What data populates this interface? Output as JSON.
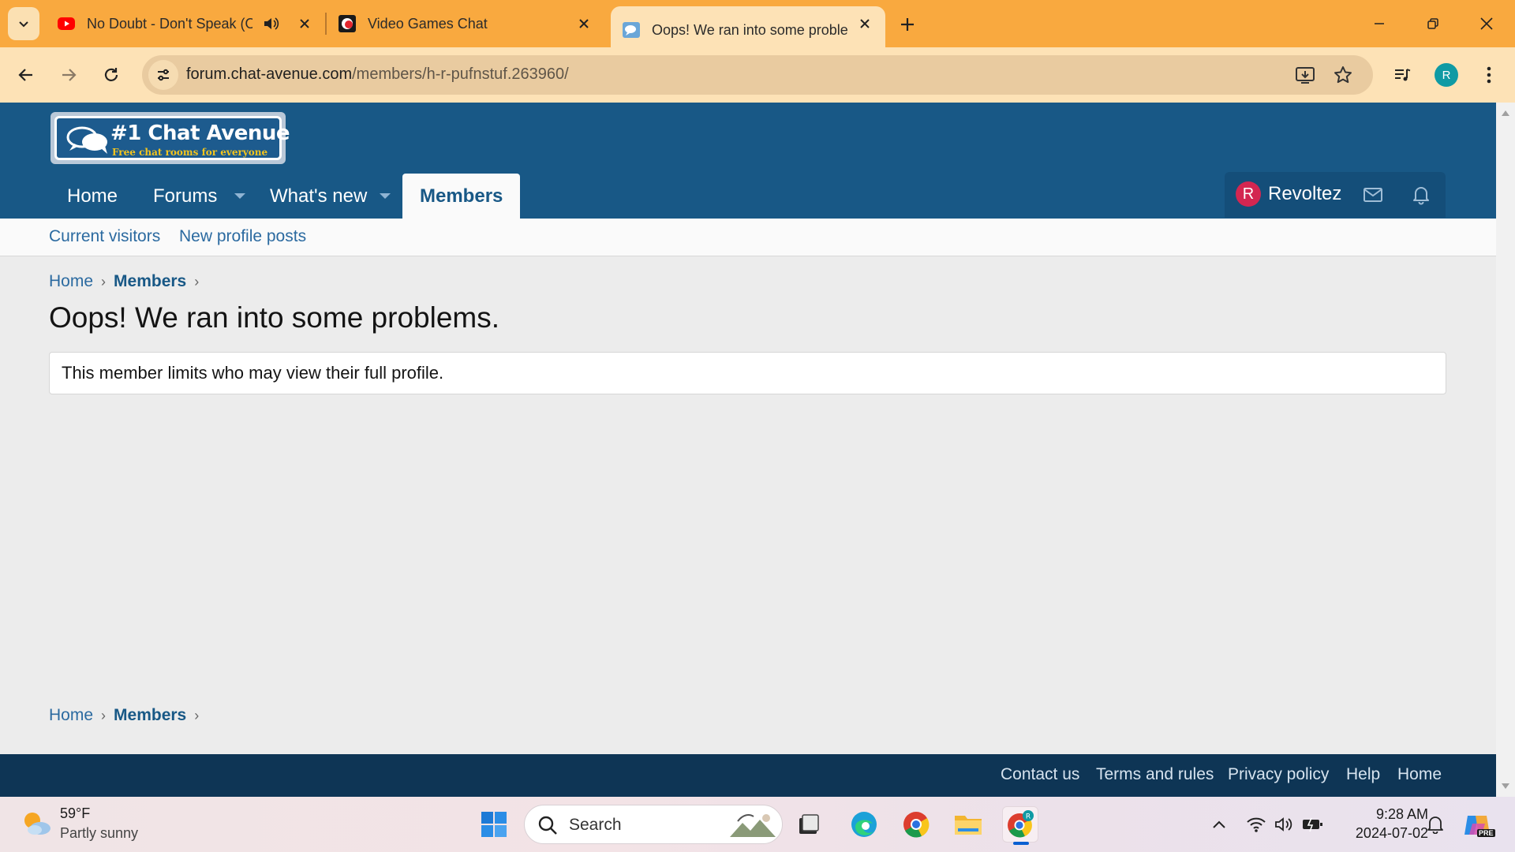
{
  "browser": {
    "tabs": [
      {
        "title": "No Doubt - Don't Speak (Official",
        "audible": true,
        "active": false
      },
      {
        "title": "Video Games Chat",
        "active": false
      },
      {
        "title": "Oops! We ran into some problems.",
        "active": true
      }
    ],
    "url_domain": "forum.chat-avenue.com",
    "url_path": "/members/h-r-pufnstuf.263960/",
    "profile_initial": "R"
  },
  "site": {
    "logo_title": "#1 Chat Avenue",
    "logo_subtitle": "Free chat rooms for everyone",
    "nav": {
      "home": "Home",
      "forums": "Forums",
      "whats_new": "What's new",
      "members": "Members"
    },
    "user": {
      "initial": "R",
      "name": "Revoltez"
    },
    "subnav": {
      "current_visitors": "Current visitors",
      "new_profile_posts": "New profile posts"
    },
    "breadcrumb": {
      "home": "Home",
      "members": "Members",
      "separator": "›"
    },
    "page_title": "Oops! We ran into some problems.",
    "notice": "This member limits who may view their full profile.",
    "footer": {
      "contact": "Contact us",
      "terms": "Terms and rules",
      "privacy": "Privacy policy",
      "help": "Help",
      "home": "Home"
    }
  },
  "taskbar": {
    "weather_temp": "59°F",
    "weather_desc": "Partly sunny",
    "search_label": "Search",
    "time": "9:28 AM",
    "date": "2024-07-02",
    "copilot_badge": "PRE"
  },
  "colors": {
    "tab_strip": "#f9a93f",
    "toolbar": "#fde2b6",
    "site_header": "#185886",
    "footer": "#0e3555",
    "link": "#2b6aa0"
  }
}
